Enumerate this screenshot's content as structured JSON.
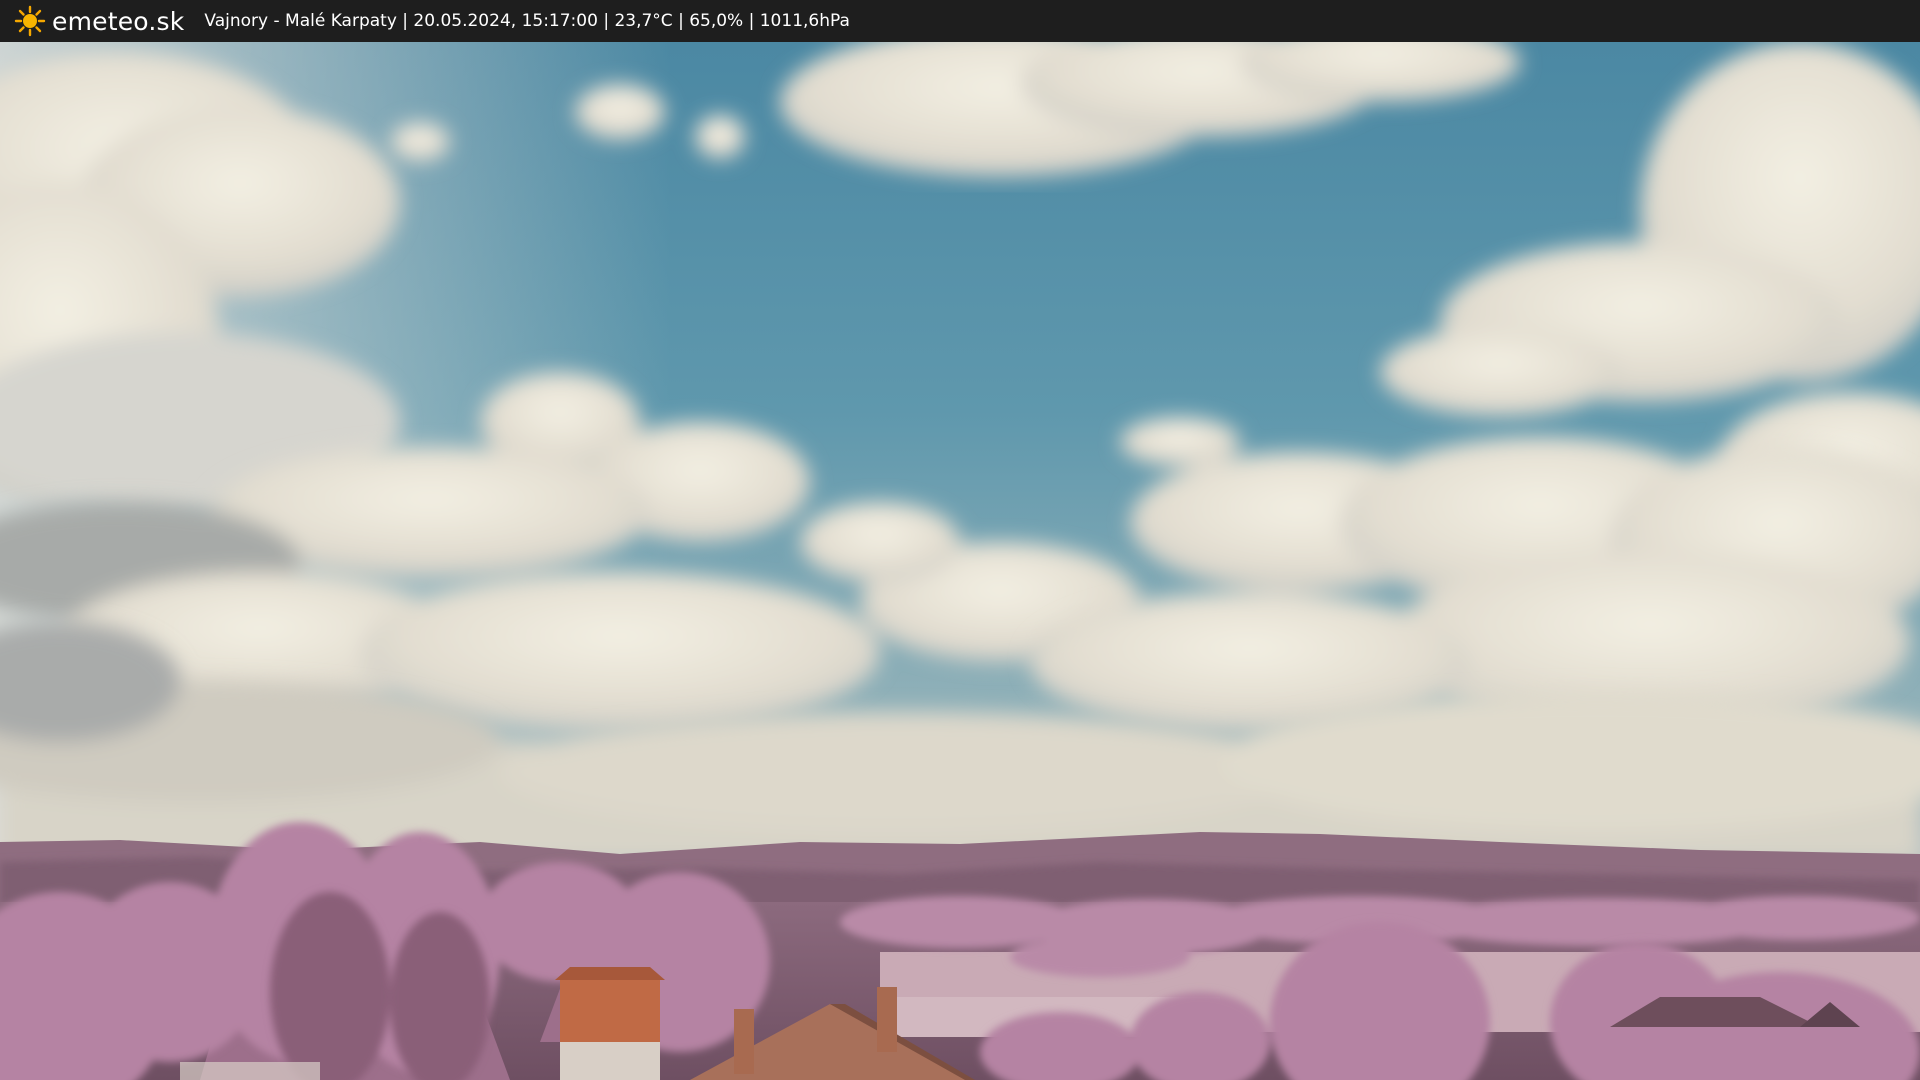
{
  "header": {
    "logo_icon": "sun-icon",
    "brand": "emeteo.sk",
    "info": "Vajnory - Malé Karpaty | 20.05.2024, 15:17:00 | 23,7°C | 65,0% | 1011,6hPa"
  },
  "colors": {
    "bar": "#1e1e1e",
    "sky_top": "#4a86a0",
    "cloud": "#e9e4d6",
    "foliage": "#b07a9c",
    "roof": "#b47555"
  }
}
